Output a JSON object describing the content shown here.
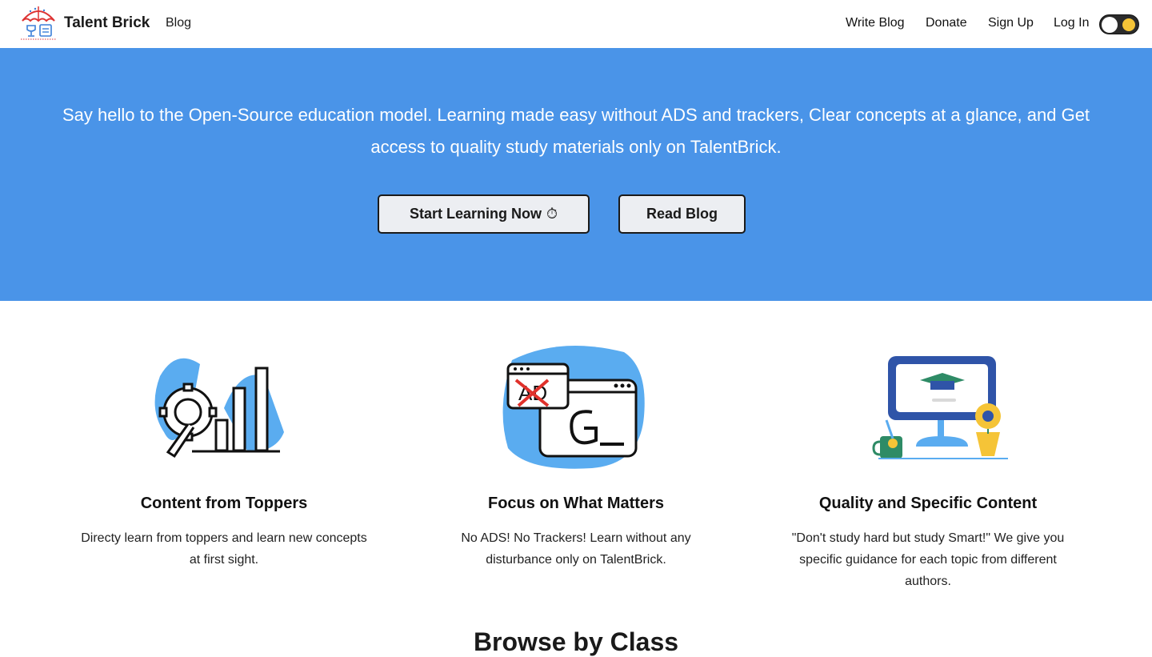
{
  "navbar": {
    "brand": "Talent Brick",
    "blog": "Blog",
    "write_blog": "Write Blog",
    "donate": "Donate",
    "sign_up": "Sign Up",
    "log_in": "Log In",
    "toggle_icon": "sun-face-icon"
  },
  "hero": {
    "text": "Say hello to the Open-Source education model. Learning made easy without ADS and trackers, Clear concepts at a glance, and Get access to quality study materials only on TalentBrick.",
    "start_button": "Start Learning Now",
    "start_button_icon": "⏱",
    "read_button": "Read Blog",
    "background": "#4a94e8"
  },
  "features": [
    {
      "title": "Content from Toppers",
      "desc": "Directy learn from toppers and learn new concepts at first sight.",
      "icon": "gear-chart-illustration"
    },
    {
      "title": "Focus on What Matters",
      "desc": "No ADS! No Trackers! Learn without any disturbance only on TalentBrick.",
      "icon": "no-ads-illustration"
    },
    {
      "title": "Quality and Specific Content",
      "desc": "\"Don't study hard but study Smart!\" We give you specific guidance for each topic from different authors.",
      "icon": "graduation-monitor-illustration"
    }
  ],
  "browse": {
    "title": "Browse by Class"
  },
  "colors": {
    "accent": "#4a94e8",
    "blob": "#5aacf0",
    "dark_blue": "#2f54a8",
    "green": "#2e8b66",
    "yellow": "#f5c437"
  }
}
